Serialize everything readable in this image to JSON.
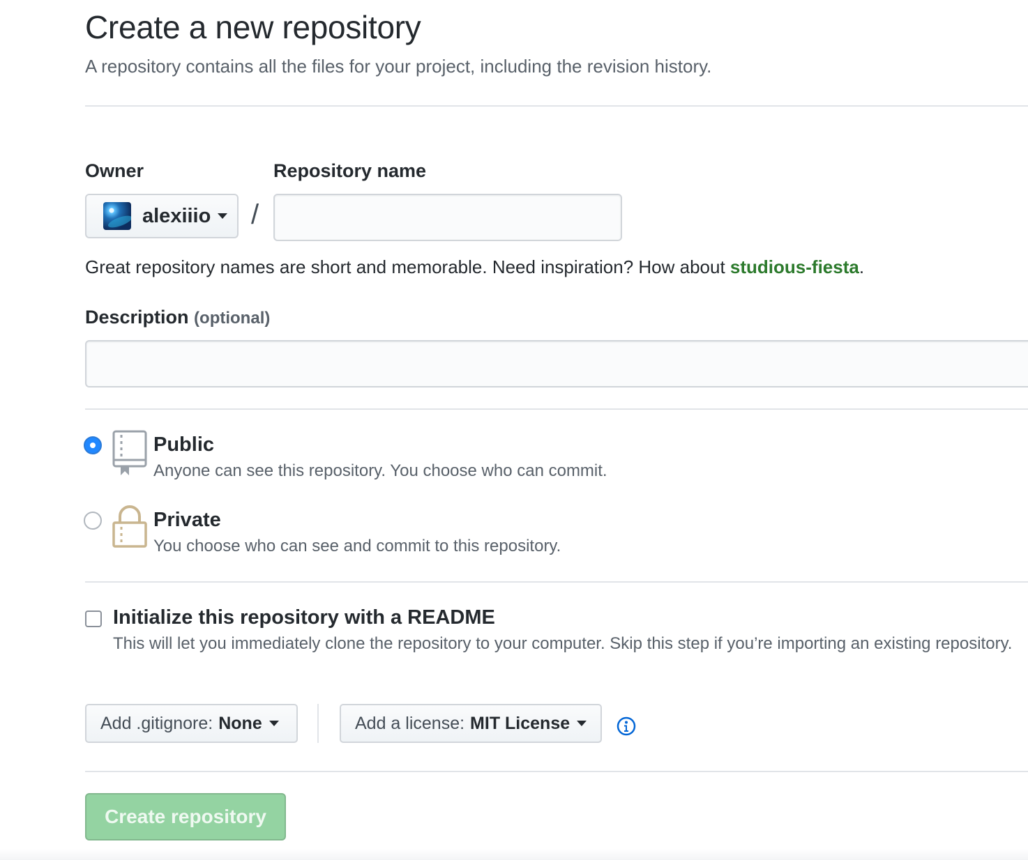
{
  "header": {
    "title": "Create a new repository",
    "subtitle": "A repository contains all the files for your project, including the revision history."
  },
  "owner": {
    "label": "Owner",
    "name": "alexiiio",
    "slash": "/"
  },
  "repo_name": {
    "label": "Repository name",
    "value": "",
    "placeholder": ""
  },
  "name_hint": {
    "prefix": "Great repository names are short and memorable. Need inspiration? How about ",
    "suggestion": "studious-fiesta",
    "suffix": "."
  },
  "description": {
    "label": "Description",
    "optional": "(optional)",
    "value": "",
    "placeholder": ""
  },
  "visibility": {
    "public": {
      "title": "Public",
      "description": "Anyone can see this repository. You choose who can commit.",
      "selected": true
    },
    "private": {
      "title": "Private",
      "description": "You choose who can see and commit to this repository.",
      "selected": false
    }
  },
  "readme": {
    "title": "Initialize this repository with a README",
    "description": "This will let you immediately clone the repository to your computer. Skip this step if you’re importing an existing repository.",
    "checked": false
  },
  "gitignore": {
    "label": "Add .gitignore:",
    "value": "None"
  },
  "license": {
    "label": "Add a license:",
    "value": "MIT License"
  },
  "icons": {
    "owner_caret": "caret-down-icon",
    "public": "repo-book-icon",
    "private": "lock-icon",
    "info": "info-icon"
  },
  "colors": {
    "suggestion": "#2c7a2c",
    "radio_selected": "#2188ff",
    "create_button": "#94d3a2",
    "info_icon": "#0366d6",
    "private_lock": "#c9b58f"
  },
  "submit": {
    "label": "Create repository",
    "enabled": false
  }
}
